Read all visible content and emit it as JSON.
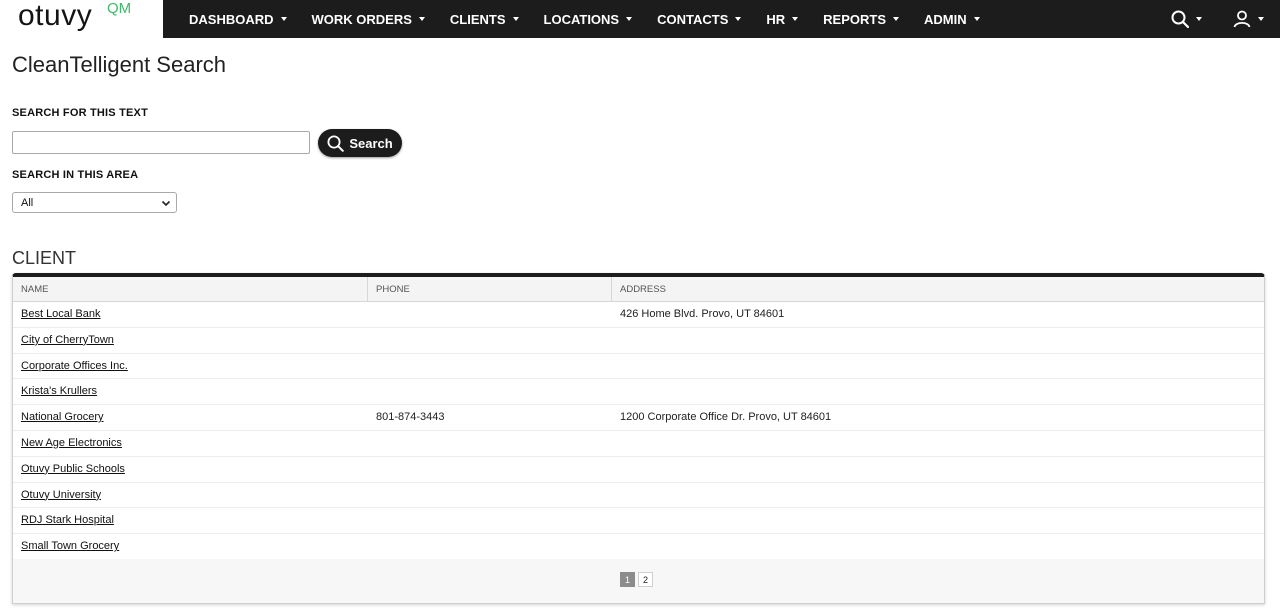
{
  "brand": {
    "logo_text": "otuvy",
    "logo_suffix": "QM"
  },
  "nav": {
    "items": [
      {
        "label": "DASHBOARD"
      },
      {
        "label": "WORK ORDERS"
      },
      {
        "label": "CLIENTS"
      },
      {
        "label": "LOCATIONS"
      },
      {
        "label": "CONTACTS"
      },
      {
        "label": "HR"
      },
      {
        "label": "REPORTS"
      },
      {
        "label": "ADMIN"
      }
    ],
    "right_icons": [
      "search-icon",
      "user-icon"
    ]
  },
  "page": {
    "title": "CleanTelligent Search",
    "search_label": "SEARCH FOR THIS TEXT",
    "search_value": "",
    "search_button": "Search",
    "area_label": "SEARCH IN THIS AREA",
    "area_selected": "All"
  },
  "results": {
    "section_title": "CLIENT",
    "columns": [
      "NAME",
      "PHONE",
      "ADDRESS"
    ],
    "rows": [
      {
        "name": "Best Local Bank",
        "phone": "",
        "address": "426 Home Blvd. Provo, UT 84601"
      },
      {
        "name": "City of CherryTown",
        "phone": "",
        "address": ""
      },
      {
        "name": "Corporate Offices Inc.",
        "phone": "",
        "address": ""
      },
      {
        "name": "Krista's Krullers",
        "phone": "",
        "address": ""
      },
      {
        "name": "National Grocery",
        "phone": "801-874-3443",
        "address": "1200 Corporate Office Dr. Provo, UT 84601"
      },
      {
        "name": "New Age Electronics",
        "phone": "",
        "address": ""
      },
      {
        "name": "Otuvy Public Schools",
        "phone": "",
        "address": ""
      },
      {
        "name": "Otuvy University",
        "phone": "",
        "address": ""
      },
      {
        "name": "RDJ Stark Hospital",
        "phone": "",
        "address": ""
      },
      {
        "name": "Small Town Grocery",
        "phone": "",
        "address": ""
      }
    ],
    "pagination": {
      "pages": [
        "1",
        "2"
      ],
      "current": "1"
    }
  },
  "colors": {
    "nav_bg": "#1c1c1c",
    "accent": "#3fb96b",
    "button_bg": "#1c1c1c"
  }
}
